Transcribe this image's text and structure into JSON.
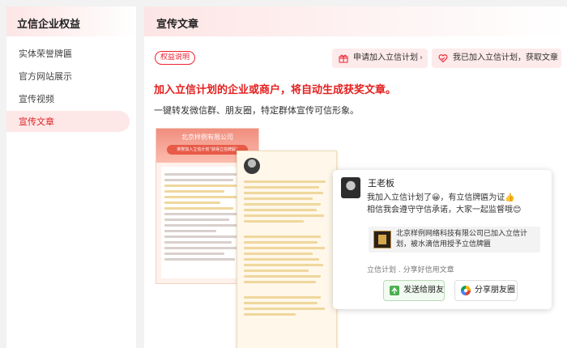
{
  "sidebar": {
    "title": "立信企业权益",
    "items": [
      {
        "label": "实体荣誉牌匾"
      },
      {
        "label": "官方网站展示"
      },
      {
        "label": "宣传视频"
      },
      {
        "label": "宣传文章",
        "active": true
      }
    ]
  },
  "main": {
    "title": "宣传文章",
    "badge": "权益说明",
    "links": [
      {
        "label": "申请加入立信计划",
        "icon": "gift-icon"
      },
      {
        "label": "我已加入立信计划，获取文章",
        "icon": "heart-icon"
      }
    ],
    "headline": "加入立信计划的企业或商户，将自动生成获奖文章。",
    "subline": "一键转发微信群、朋友圈，特定群体宣传可信形象。"
  },
  "poster1": {
    "company": "北京样例有限公司",
    "ribbon": "荣誉加入立信计划“获得立信牌匾”"
  },
  "share_card": {
    "name": "王老板",
    "message_line1": "我加入立信计划了😀，有立信牌匾为证👍",
    "message_line2": "相信我会遵守守信承诺，大家一起监督哦😊",
    "card_text": "北京样例网络科技有限公司已加入立信计划，被水滴信用授予立信牌匾",
    "caption": "立信计划 . 分享好信用文章",
    "btn_wechat": "发送给朋友",
    "btn_moments": "分享朋友圈"
  },
  "colors": {
    "accent": "#e2201f",
    "active_bg": "#fde7e7",
    "poster_header": "#f18e7f"
  }
}
